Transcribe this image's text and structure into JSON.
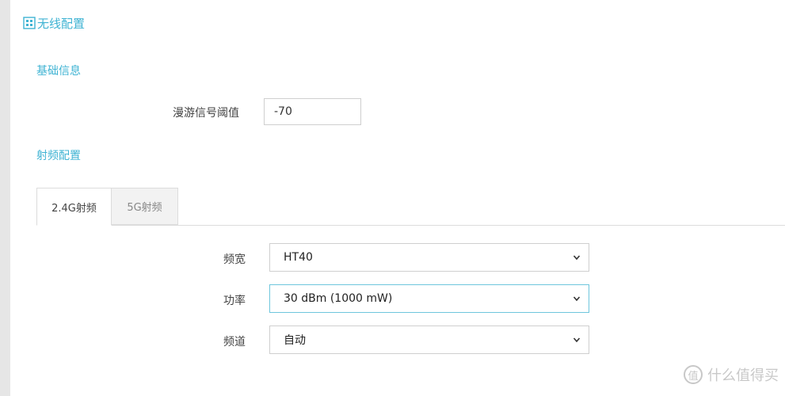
{
  "page": {
    "title": "无线配置",
    "title_icon": "grid-icon"
  },
  "basic": {
    "section_title": "基础信息",
    "roaming_label": "漫游信号阈值",
    "roaming_value": "-70"
  },
  "radio": {
    "section_title": "射频配置",
    "tabs": [
      {
        "label": "2.4G射频",
        "active": true
      },
      {
        "label": "5G射频",
        "active": false
      }
    ],
    "fields": {
      "bandwidth": {
        "label": "频宽",
        "value": "HT40"
      },
      "power": {
        "label": "功率",
        "value": "30 dBm (1000 mW)"
      },
      "channel": {
        "label": "频道",
        "value": "自动"
      }
    }
  },
  "watermark": {
    "icon": "zhi-icon",
    "text": "什么值得买"
  },
  "colors": {
    "accent": "#3fb3d3",
    "focus_border": "#6ec6dd"
  }
}
